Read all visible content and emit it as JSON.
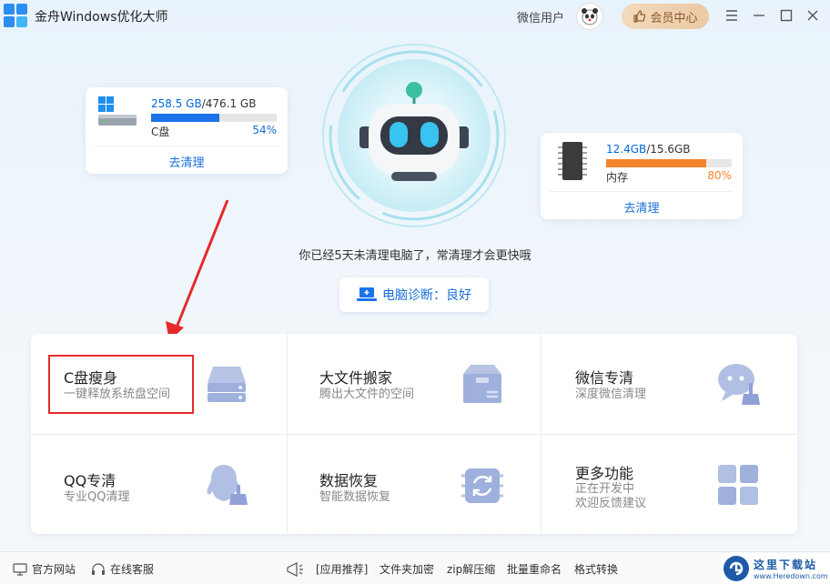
{
  "app": {
    "title": "金舟Windows优化大师"
  },
  "header": {
    "user_name": "微信用户",
    "member_label": "会员中心"
  },
  "disk_c": {
    "used": "258.5 GB",
    "total": "/476.1 GB",
    "label": "C盘",
    "percent": "54%",
    "percent_value": 54,
    "action": "去清理"
  },
  "memory": {
    "used": "12.4GB",
    "total": "/15.6GB",
    "label": "内存",
    "percent": "80%",
    "percent_value": 80,
    "action": "去清理"
  },
  "status": {
    "message": "你已经5天未清理电脑了，常清理才会更快哦",
    "diagnosis": "电脑诊断：良好"
  },
  "tools": [
    {
      "title": "C盘瘦身",
      "sub": "一键释放系统盘空间"
    },
    {
      "title": "大文件搬家",
      "sub": "腾出大文件的空间"
    },
    {
      "title": "微信专清",
      "sub": "深度微信清理"
    },
    {
      "title": "QQ专清",
      "sub": "专业QQ清理"
    },
    {
      "title": "数据恢复",
      "sub": "智能数据恢复"
    },
    {
      "title": "更多功能",
      "sub": "正在开发中",
      "sub2": "欢迎反馈建议"
    }
  ],
  "footer": {
    "website": "官方网站",
    "service": "在线客服",
    "recommend": "[应用推荐]",
    "links": [
      "文件夹加密",
      "zip解压缩",
      "批量重命名",
      "格式转换"
    ]
  },
  "watermark": {
    "title": "这里下载站",
    "url": "www.Heredown.com"
  },
  "colors": {
    "accent": "#1a6fd6",
    "disk_bar": "#1a73e8",
    "mem_bar": "#f5832b",
    "highlight": "#e52a2a"
  }
}
